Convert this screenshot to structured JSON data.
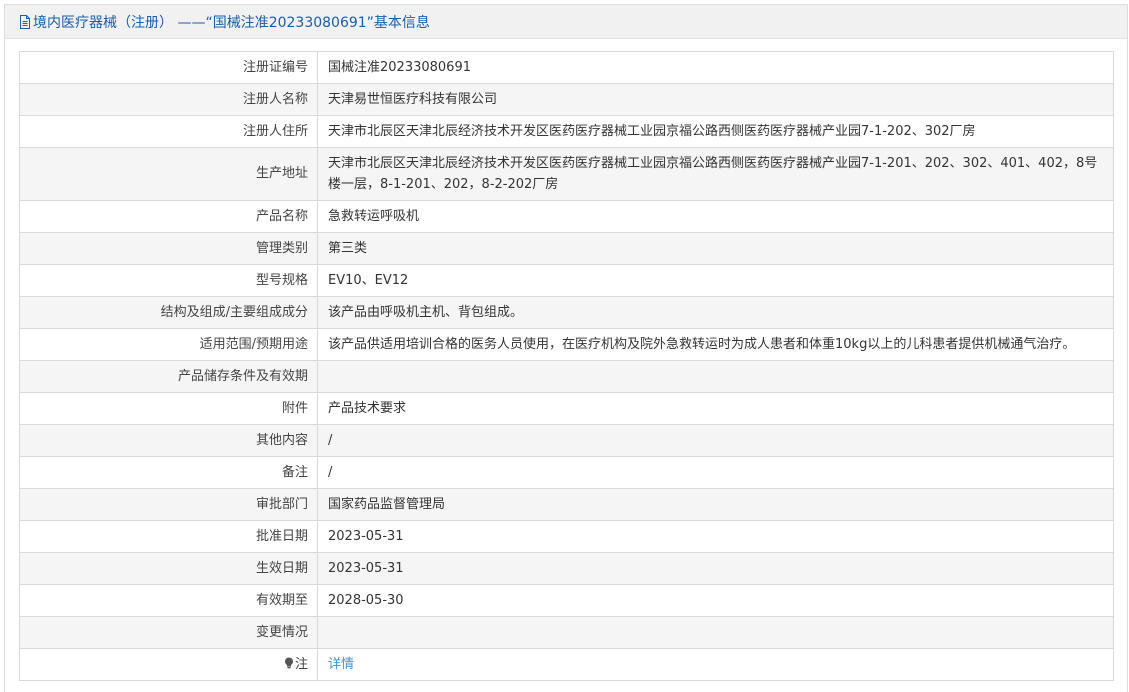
{
  "header": {
    "title": "境内医疗器械（注册） ——“国械注准20233080691”基本信息",
    "icon": "document-icon"
  },
  "rows": [
    {
      "label": "注册证编号",
      "value": "国械注准20233080691"
    },
    {
      "label": "注册人名称",
      "value": "天津易世恒医疗科技有限公司"
    },
    {
      "label": "注册人住所",
      "value": "天津市北辰区天津北辰经济技术开发区医药医疗器械工业园京福公路西侧医药医疗器械产业园7-1-202、302厂房"
    },
    {
      "label": "生产地址",
      "value": "天津市北辰区天津北辰经济技术开发区医药医疗器械工业园京福公路西侧医药医疗器械产业园7-1-201、202、302、401、402，8号楼一层，8-1-201、202，8-2-202厂房"
    },
    {
      "label": "产品名称",
      "value": "急救转运呼吸机"
    },
    {
      "label": "管理类别",
      "value": "第三类"
    },
    {
      "label": "型号规格",
      "value": "EV10、EV12"
    },
    {
      "label": "结构及组成/主要组成成分",
      "value": "该产品由呼吸机主机、背包组成。"
    },
    {
      "label": "适用范围/预期用途",
      "value": "该产品供适用培训合格的医务人员使用，在医疗机构及院外急救转运时为成人患者和体重10kg以上的儿科患者提供机械通气治疗。"
    },
    {
      "label": "产品储存条件及有效期",
      "value": ""
    },
    {
      "label": "附件",
      "value": "产品技术要求"
    },
    {
      "label": "其他内容",
      "value": "/"
    },
    {
      "label": "备注",
      "value": "/"
    },
    {
      "label": "审批部门",
      "value": "国家药品监督管理局"
    },
    {
      "label": "批准日期",
      "value": "2023-05-31"
    },
    {
      "label": "生效日期",
      "value": "2023-05-31"
    },
    {
      "label": "有效期至",
      "value": "2028-05-30"
    },
    {
      "label": "变更情况",
      "value": ""
    }
  ],
  "note_row": {
    "label": "注",
    "icon": "lightbulb-icon",
    "link_text": "详情"
  },
  "colors": {
    "heading_text": "#1a5ea8",
    "link": "#3e8fd3",
    "stripe": "#f5f5f5",
    "border": "#d9d9d9"
  }
}
